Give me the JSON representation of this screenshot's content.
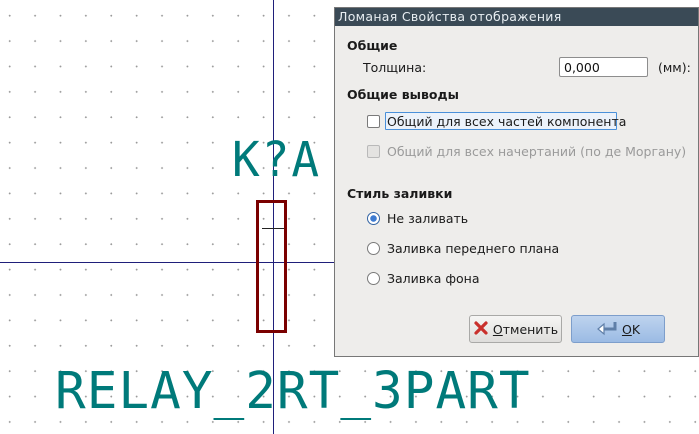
{
  "canvas": {
    "reference": "K?A",
    "value": "RELAY_2RT_3PART"
  },
  "dialog": {
    "title": "Ломаная Свойства отображения",
    "general": {
      "heading": "Общие",
      "thickness_label": "Толщина:",
      "thickness_value": "0,000",
      "unit": "(мм):"
    },
    "shared": {
      "heading": "Общие выводы",
      "all_parts": {
        "label": "Общий для всех частей компонента",
        "checked": false,
        "enabled": true
      },
      "all_styles": {
        "label": "Общий для всех начертаний (по де Моргану)",
        "checked": false,
        "enabled": false
      }
    },
    "fill": {
      "heading": "Стиль заливки",
      "options": [
        {
          "label": "Не заливать",
          "selected": true
        },
        {
          "label": "Заливка переднего плана",
          "selected": false
        },
        {
          "label": "Заливка фона",
          "selected": false
        }
      ]
    },
    "buttons": {
      "cancel": {
        "accel": "О",
        "rest": "тменить",
        "icon": "cancel-x-icon"
      },
      "ok": {
        "accel": "O",
        "rest": "K",
        "icon": "ok-return-icon"
      }
    }
  },
  "colors": {
    "text_field": "#007a7a",
    "symbol_body": "#7a0000",
    "crosshair": "#1f1f7a",
    "titlebar": "#3a4a56",
    "accent": "#3465a4"
  }
}
